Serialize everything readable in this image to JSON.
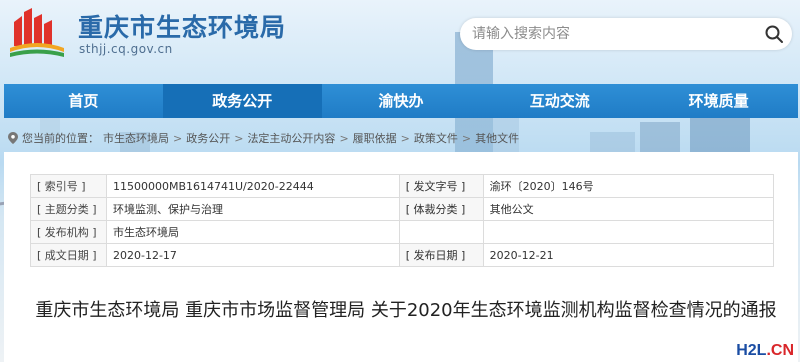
{
  "header": {
    "title": "重庆市生态环境局",
    "domain": "sthjj.cq.gov.cn"
  },
  "search": {
    "placeholder": "请输入搜索内容"
  },
  "nav": {
    "items": [
      {
        "label": "首页"
      },
      {
        "label": "政务公开"
      },
      {
        "label": "渝快办"
      },
      {
        "label": "互动交流"
      },
      {
        "label": "环境质量"
      }
    ],
    "active_index": 1
  },
  "breadcrumb": {
    "prefix": "您当前的位置：",
    "items": [
      "市生态环境局",
      "政务公开",
      "法定主动公开内容",
      "履职依据",
      "政策文件",
      "其他文件"
    ]
  },
  "meta": {
    "rows": [
      {
        "k1": "[ 索引号 ]",
        "v1": "11500000MB1614741U/2020-22444",
        "k2": "[ 发文字号 ]",
        "v2": "渝环〔2020〕146号"
      },
      {
        "k1": "[ 主题分类 ]",
        "v1": "环境监测、保护与治理",
        "k2": "[ 体裁分类 ]",
        "v2": "其他公文"
      },
      {
        "k1": "[ 发布机构 ]",
        "v1": "市生态环境局",
        "k2": "",
        "v2": ""
      },
      {
        "k1": "[ 成文日期 ]",
        "v1": "2020-12-17",
        "k2": "[ 发布日期 ]",
        "v2": "2020-12-21"
      }
    ]
  },
  "document": {
    "title": "重庆市生态环境局 重庆市市场监督管理局 关于2020年生态环境监测机构监督检查情况的通报"
  },
  "watermark": {
    "part1": "H2L",
    "part2": ".CN"
  },
  "colors": {
    "nav": "#1f7cc6",
    "title": "#2a6aa9"
  }
}
